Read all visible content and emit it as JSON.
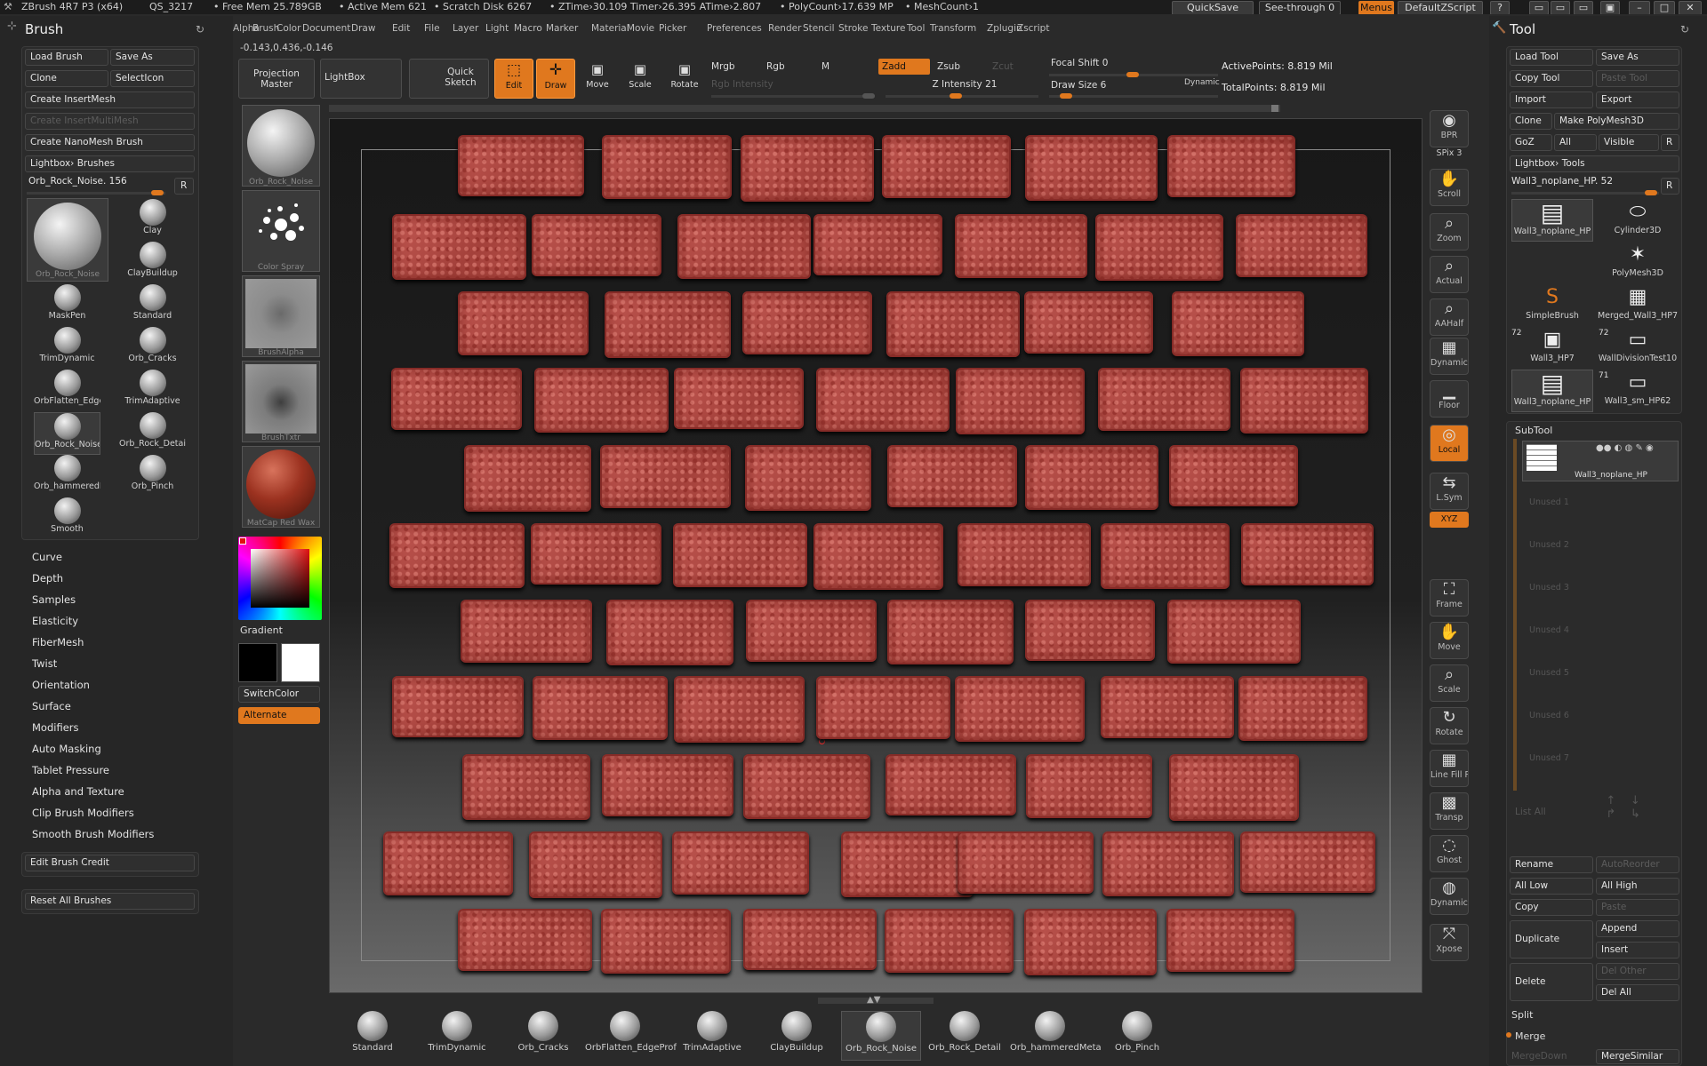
{
  "titlebar": {
    "app": "ZBrush 4R7 P3 (x64)",
    "qs": "QS_3217",
    "free_mem": "• Free Mem 25.789GB",
    "active_mem": "• Active Mem 621",
    "scratch": "• Scratch Disk 6267",
    "ztime": "• ZTime›30.109 Timer›26.395 ATime›2.807",
    "polycount": "• PolyCount›17.639 MP",
    "meshcount": "• MeshCount›1",
    "quicksave": "QuickSave",
    "see_through": "See-through  0",
    "menus": "Menus",
    "zscript": "DefaultZScript"
  },
  "menubar": [
    "Alpha",
    "Brush",
    "Color",
    "Document",
    "Draw",
    "Edit",
    "File",
    "Layer",
    "Light",
    "Macro",
    "Marker",
    "Material",
    "Movie",
    "Picker",
    "Preferences",
    "Render",
    "Stencil",
    "Stroke",
    "Texture",
    "Tool",
    "Transform",
    "Zplugin",
    "Zscript"
  ],
  "coords": "-0.143,0.436,-0.146",
  "brush_panel": {
    "title": "Brush",
    "load": "Load Brush",
    "save_as": "Save As",
    "clone": "Clone",
    "select_icon": "SelectIcon",
    "create_insert": "Create InsertMesh",
    "create_insert_multi": "Create InsertMultiMesh",
    "create_nano": "Create NanoMesh Brush",
    "lightbox": "Lightbox› Brushes",
    "current": "Orb_Rock_Noise. 156",
    "r": "R",
    "cells": [
      {
        "label": "Clay"
      },
      {
        "label": "ClayBuildup"
      },
      {
        "label": "MaskPen"
      },
      {
        "label": "Standard"
      },
      {
        "label": "TrimDynamic"
      },
      {
        "label": "Orb_Cracks"
      },
      {
        "label": "OrbFlatten_EdgeProf"
      },
      {
        "label": "TrimAdaptive"
      },
      {
        "label": "Orb_Rock_Noise"
      },
      {
        "label": "Orb_Rock_Detail"
      },
      {
        "label": "Orb_hammeredMeta"
      },
      {
        "label": "Orb_Pinch"
      },
      {
        "label": "Smooth"
      }
    ],
    "big_label": "Orb_Rock_Noise",
    "subpalettes": [
      "Curve",
      "Depth",
      "Samples",
      "Elasticity",
      "FiberMesh",
      "Twist",
      "Orientation",
      "Surface",
      "Modifiers",
      "Auto Masking",
      "Tablet Pressure",
      "Alpha and Texture",
      "Clip Brush Modifiers",
      "Smooth Brush Modifiers"
    ],
    "edit_credit": "Edit Brush Credit",
    "reset": "Reset All Brushes"
  },
  "toolbar": {
    "projection_master": "Projection Master",
    "lightbox": "LightBox",
    "quick_sketch": "Quick Sketch",
    "edit": "Edit",
    "draw": "Draw",
    "move": "Move",
    "scale": "Scale",
    "rotate": "Rotate",
    "mrgb": "Mrgb",
    "rgb": "Rgb",
    "m": "M",
    "zadd": "Zadd",
    "zsub": "Zsub",
    "zcut": "Zcut",
    "rgb_intensity": "Rgb Intensity",
    "z_intensity": "Z Intensity 21",
    "focal_shift": "Focal Shift 0",
    "draw_size": "Draw Size 6",
    "dynamic": "Dynamic",
    "active_points": "ActivePoints: 8.819 Mil",
    "total_points": "TotalPoints: 8.819 Mil"
  },
  "left_thumbs": {
    "material": "Orb_Rock_Noise",
    "stroke": "Color Spray",
    "alpha": "BrushAlpha",
    "texture": "BrushTxtr",
    "matcap": "MatCap Red Wax",
    "gradient": "Gradient",
    "switch_color": "SwitchColor",
    "alternate": "Alternate"
  },
  "shelf": [
    "BPR",
    "SPix 3",
    "Scroll",
    "Zoom",
    "Actual",
    "AAHalf",
    "Dynamic Persp",
    "Floor",
    "Local",
    "L.Sym",
    "XYZ",
    "Frame",
    "Move",
    "Scale",
    "Rotate",
    "Line Fill PolyF",
    "Transp",
    "Ghost",
    "Dynamic Solo",
    "Xpose"
  ],
  "tool_panel": {
    "title": "Tool",
    "load": "Load Tool",
    "save_as": "Save As",
    "copy_tool": "Copy Tool",
    "paste_tool": "Paste Tool",
    "import": "Import",
    "export": "Export",
    "clone": "Clone",
    "make_poly": "Make PolyMesh3D",
    "goz": "GoZ",
    "all": "All",
    "visible": "Visible",
    "r": "R",
    "lightbox": "Lightbox› Tools",
    "current": "Wall3_noplane_HP. 52",
    "tools": [
      {
        "label": "Wall3_noplane_HP"
      },
      {
        "label": "Cylinder3D"
      },
      {
        "label": "PolyMesh3D"
      },
      {
        "label": "SimpleBrush"
      },
      {
        "label": "Merged_Wall3_HP7"
      },
      {
        "label": "Wall3_HP7"
      },
      {
        "label": "WallDivisionTest10"
      },
      {
        "label": "Wall3_noplane_HP"
      },
      {
        "label": "Wall3_sm_HP62"
      }
    ],
    "num_72a": "72",
    "num_72b": "72",
    "num_71": "71",
    "subtool": "SubTool",
    "subtool_item": "Wall3_noplane_HP",
    "unused": [
      "Unused 1",
      "Unused 2",
      "Unused 3",
      "Unused 4",
      "Unused 5",
      "Unused 6",
      "Unused 7"
    ],
    "list_all": "List All",
    "rename": "Rename",
    "auto_reorder": "AutoReorder",
    "all_low": "All Low",
    "all_high": "All High",
    "copy": "Copy",
    "paste": "Paste",
    "duplicate": "Duplicate",
    "append": "Append",
    "insert": "Insert",
    "delete": "Delete",
    "del_other": "Del Other",
    "del_all": "Del All",
    "split": "Split",
    "merge": "Merge",
    "merge_down": "MergeDown",
    "merge_similar": "MergeSimilar"
  },
  "bottom_brushes": [
    "Standard",
    "TrimDynamic",
    "Orb_Cracks",
    "OrbFlatten_EdgeProf",
    "TrimAdaptive",
    "ClayBuildup",
    "Orb_Rock_Noise",
    "Orb_Rock_Detail",
    "Orb_hammeredMeta",
    "Orb_Pinch"
  ],
  "colors": {
    "accent": "#e0781e",
    "brick": "#b24a44",
    "panel": "#262626"
  }
}
